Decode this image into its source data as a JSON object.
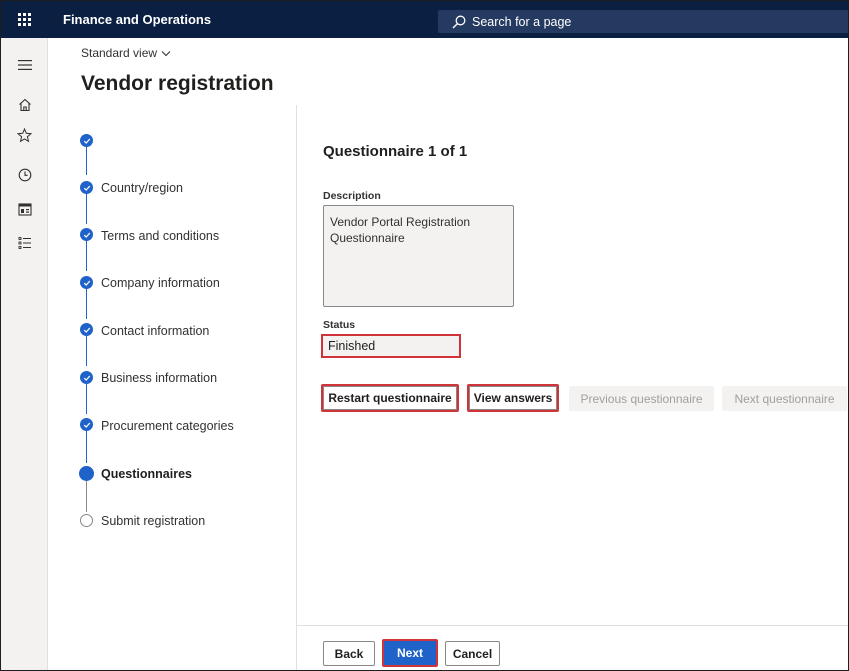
{
  "app": {
    "title": "Finance and Operations",
    "search_placeholder": "Search for a page"
  },
  "nav_rail": {
    "items": [
      {
        "icon": "hamburger-icon"
      },
      {
        "icon": "home-icon"
      },
      {
        "icon": "star-icon"
      },
      {
        "icon": "clock-icon"
      },
      {
        "icon": "workspace-icon"
      },
      {
        "icon": "list-icon"
      }
    ]
  },
  "header": {
    "view_label": "Standard view",
    "page_title": "Vendor registration"
  },
  "steps": [
    {
      "label": "",
      "state": "completed"
    },
    {
      "label": "Country/region",
      "state": "completed"
    },
    {
      "label": "Terms and conditions",
      "state": "completed"
    },
    {
      "label": "Company information",
      "state": "completed"
    },
    {
      "label": "Contact information",
      "state": "completed"
    },
    {
      "label": "Business information",
      "state": "completed"
    },
    {
      "label": "Procurement categories",
      "state": "completed"
    },
    {
      "label": "Questionnaires",
      "state": "current"
    },
    {
      "label": "Submit registration",
      "state": "pending"
    }
  ],
  "questionnaire": {
    "title": "Questionnaire 1 of 1",
    "description_label": "Description",
    "description_value": "Vendor Portal Registration Questionnaire",
    "status_label": "Status",
    "status_value": "Finished",
    "buttons": {
      "restart": "Restart questionnaire",
      "view_answers": "View answers",
      "previous": "Previous questionnaire",
      "next": "Next questionnaire"
    }
  },
  "footer": {
    "back": "Back",
    "next": "Next",
    "cancel": "Cancel"
  },
  "colors": {
    "topbar": "#0b1f42",
    "accent": "#1f62c9",
    "highlight": "#d13438"
  }
}
